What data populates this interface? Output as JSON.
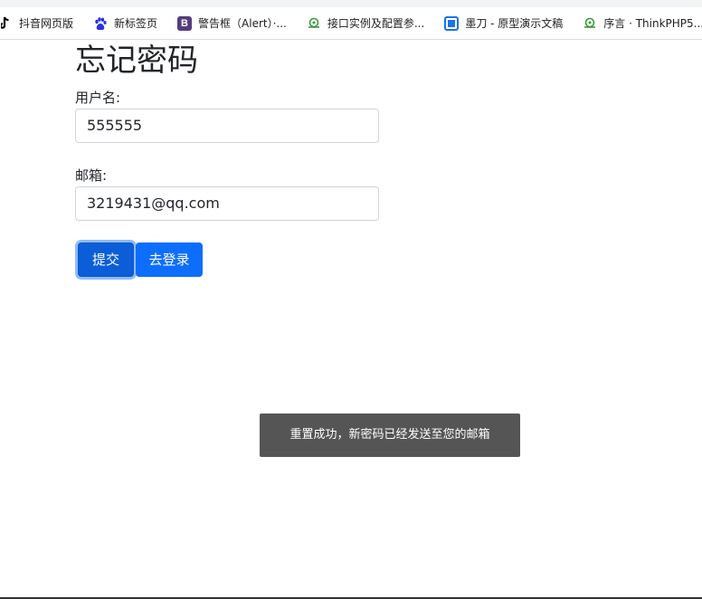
{
  "bookmarks": [
    {
      "icon": "tiktok-icon",
      "label": "抖音网页版"
    },
    {
      "icon": "baidu-paw-icon",
      "label": "新标签页"
    },
    {
      "icon": "bootstrap-icon",
      "label": "警告框（Alert）·..."
    },
    {
      "icon": "cloud-icon",
      "label": "接口实例及配置参..."
    },
    {
      "icon": "modao-icon",
      "label": "墨刀 - 原型演示文稿"
    },
    {
      "icon": "cloud-icon",
      "label": "序言 · ThinkPHP5...."
    }
  ],
  "bootstrap_icon_letter": "B",
  "form": {
    "title": "忘记密码",
    "username_label": "用户名:",
    "username_value": "555555",
    "email_label": "邮箱:",
    "email_value": "3219431@qq.com",
    "submit_label": "提交",
    "login_label": "去登录"
  },
  "toast": {
    "message": "重置成功，新密码已经发送至您的邮箱"
  },
  "colors": {
    "primary": "#0d6efd",
    "toast_bg": "#555555"
  }
}
